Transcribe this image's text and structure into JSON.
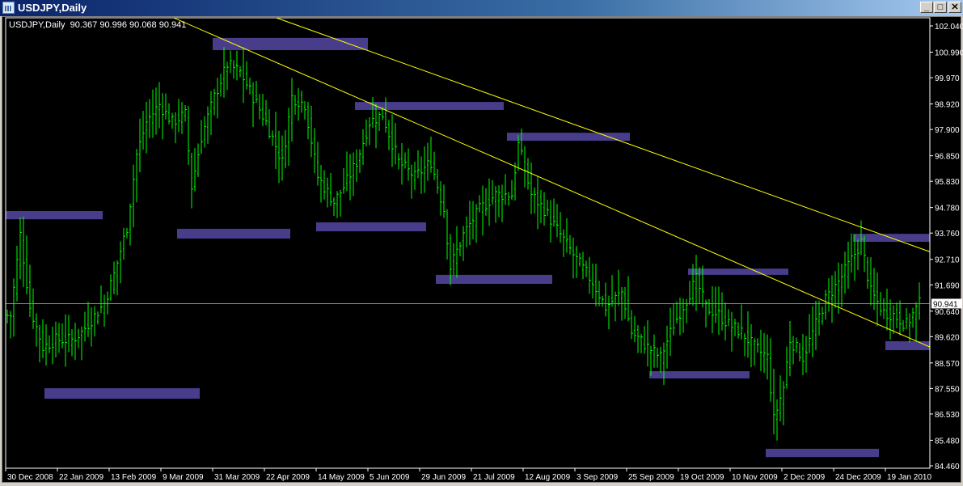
{
  "window": {
    "title": "USDJPY,Daily",
    "minimize_label": "_",
    "maximize_label": "□",
    "close_label": "✕"
  },
  "chart_info": {
    "symbol": "USDJPY,Daily",
    "ohlc": "90.367 90.996 90.068 90.941"
  },
  "chart_data": {
    "type": "ohlc",
    "symbol": "USDJPY",
    "timeframe": "Daily",
    "bar_count": 283,
    "price_range": [
      84.46,
      102.04
    ],
    "price_ticks": [
      "102.040",
      "100.990",
      "99.970",
      "98.920",
      "97.900",
      "96.850",
      "95.830",
      "94.780",
      "93.760",
      "92.710",
      "91.690",
      "90.640",
      "89.620",
      "88.570",
      "87.550",
      "86.530",
      "85.480",
      "84.460"
    ],
    "time_ticks": [
      "30 Dec 2008",
      "22 Jan 2009",
      "13 Feb 2009",
      "9 Mar 2009",
      "31 Mar 2009",
      "22 Apr 2009",
      "14 May 2009",
      "5 Jun 2009",
      "29 Jun 2009",
      "21 Jul 2009",
      "12 Aug 2009",
      "3 Sep 2009",
      "25 Sep 2009",
      "19 Oct 2009",
      "10 Nov 2009",
      "2 Dec 2009",
      "24 Dec 2009",
      "19 Jan 2010"
    ],
    "bars_per_time_tick": 16,
    "current_price": "90.941",
    "close_path": [
      [
        1,
        90.47
      ],
      [
        4,
        93.7
      ],
      [
        7,
        90.8
      ],
      [
        11,
        89.2
      ],
      [
        15,
        89.5
      ],
      [
        20,
        89.5
      ],
      [
        23,
        89.8
      ],
      [
        30,
        90.95
      ],
      [
        33,
        92.1
      ],
      [
        37,
        94.0
      ],
      [
        40,
        96.9
      ],
      [
        43,
        98.2
      ],
      [
        47,
        98.9
      ],
      [
        51,
        98.2
      ],
      [
        55,
        98.5
      ],
      [
        57,
        95.6
      ],
      [
        60,
        97.6
      ],
      [
        64,
        99.2
      ],
      [
        68,
        100.5
      ],
      [
        72,
        100.2
      ],
      [
        76,
        99.2
      ],
      [
        80,
        98.2
      ],
      [
        85,
        96.6
      ],
      [
        88,
        99.2
      ],
      [
        92,
        98.9
      ],
      [
        96,
        96.0
      ],
      [
        101,
        95.0
      ],
      [
        104,
        95.6
      ],
      [
        108,
        96.6
      ],
      [
        112,
        98.2
      ],
      [
        116,
        98.5
      ],
      [
        121,
        96.6
      ],
      [
        126,
        96.0
      ],
      [
        131,
        96.6
      ],
      [
        135,
        94.7
      ],
      [
        137,
        92.4
      ],
      [
        141,
        93.7
      ],
      [
        146,
        94.7
      ],
      [
        151,
        95.3
      ],
      [
        156,
        95.3
      ],
      [
        158,
        97.3
      ],
      [
        162,
        95.3
      ],
      [
        166,
        94.7
      ],
      [
        171,
        93.7
      ],
      [
        176,
        92.7
      ],
      [
        181,
        91.8
      ],
      [
        185,
        90.8
      ],
      [
        190,
        91.4
      ],
      [
        193,
        89.8
      ],
      [
        198,
        89.2
      ],
      [
        202,
        88.8
      ],
      [
        206,
        90.1
      ],
      [
        210,
        91.1
      ],
      [
        213,
        91.9
      ],
      [
        216,
        90.8
      ],
      [
        220,
        90.5
      ],
      [
        223,
        90.1
      ],
      [
        227,
        89.8
      ],
      [
        231,
        89.2
      ],
      [
        235,
        88.8
      ],
      [
        237,
        86.3
      ],
      [
        240,
        87.6
      ],
      [
        242,
        89.5
      ],
      [
        246,
        88.8
      ],
      [
        250,
        90.1
      ],
      [
        253,
        91.1
      ],
      [
        257,
        91.8
      ],
      [
        261,
        92.7
      ],
      [
        264,
        93.4
      ],
      [
        267,
        91.4
      ],
      [
        271,
        90.6
      ],
      [
        274,
        90.5
      ],
      [
        278,
        90.1
      ],
      [
        282,
        90.94
      ]
    ],
    "zones": [
      {
        "from_bar": 0,
        "to_bar": 30,
        "high": 94.64,
        "low": 94.31
      },
      {
        "from_bar": 12,
        "to_bar": 60,
        "high": 87.56,
        "low": 87.14
      },
      {
        "from_bar": 53,
        "to_bar": 88,
        "high": 93.93,
        "low": 93.54
      },
      {
        "from_bar": 64,
        "to_bar": 112,
        "high": 101.56,
        "low": 101.07
      },
      {
        "from_bar": 96,
        "to_bar": 130,
        "high": 94.19,
        "low": 93.83
      },
      {
        "from_bar": 108,
        "to_bar": 154,
        "high": 99.0,
        "low": 98.68
      },
      {
        "from_bar": 133,
        "to_bar": 169,
        "high": 92.09,
        "low": 91.73
      },
      {
        "from_bar": 155,
        "to_bar": 193,
        "high": 97.77,
        "low": 97.45
      },
      {
        "from_bar": 199,
        "to_bar": 230,
        "high": 88.24,
        "low": 87.95
      },
      {
        "from_bar": 211,
        "to_bar": 242,
        "high": 92.34,
        "low": 92.09
      },
      {
        "from_bar": 235,
        "to_bar": 270,
        "high": 85.14,
        "low": 84.81
      },
      {
        "from_bar": 262,
        "to_bar": 286,
        "high": 93.73,
        "low": 93.41
      },
      {
        "from_bar": 272,
        "to_bar": 286,
        "high": 89.44,
        "low": 89.08
      }
    ],
    "trendlines": [
      {
        "from": [
          51.5,
          102.36
        ],
        "to": [
          285.75,
          89.18
        ]
      },
      {
        "from": [
          83.25,
          102.36
        ],
        "to": [
          285.75,
          92.99
        ]
      }
    ],
    "colors": {
      "bars": "#00ff00",
      "zone": "#483d8b",
      "trendline": "#ffff00",
      "hline": "#7b8a9b",
      "background": "#000000",
      "axis": "#ffffff"
    }
  }
}
